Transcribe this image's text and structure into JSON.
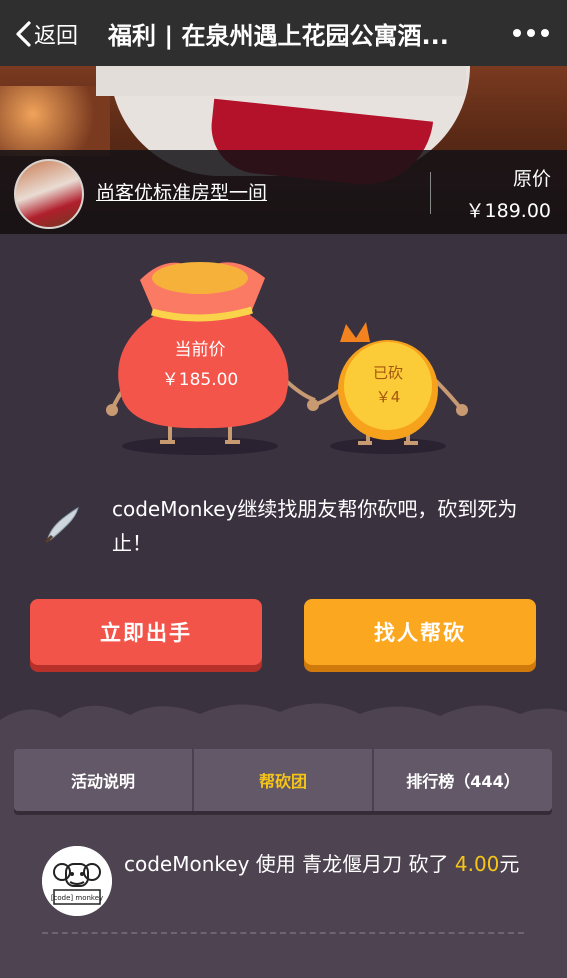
{
  "nav": {
    "back_label": "返回",
    "title": "福利 | 在泉州遇上花园公寓酒..."
  },
  "room": {
    "name": "尚客优标准房型一间",
    "orig_label": "原价",
    "orig_price": "￥189.00"
  },
  "illustration": {
    "current_label": "当前价",
    "current_price": "￥185.00",
    "cut_label": "已砍",
    "cut_amount": "￥4"
  },
  "quote": "codeMonkey继续找朋友帮你砍吧，砍到死为止！",
  "buttons": {
    "primary": "立即出手",
    "secondary": "找人帮砍"
  },
  "tabs": [
    {
      "label": "活动说明"
    },
    {
      "label": "帮砍团"
    },
    {
      "label": "排行榜（444）"
    }
  ],
  "records": [
    {
      "user": "codeMonkey",
      "action_pre": "使用",
      "weapon": "青龙偃月刀",
      "action_post": "砍了",
      "amount": "4.00",
      "unit": "元",
      "avatar_text": "[code] monkey"
    }
  ],
  "colors": {
    "accent_red": "#f3544a",
    "accent_orange": "#fca720",
    "highlight": "#f5c518"
  }
}
